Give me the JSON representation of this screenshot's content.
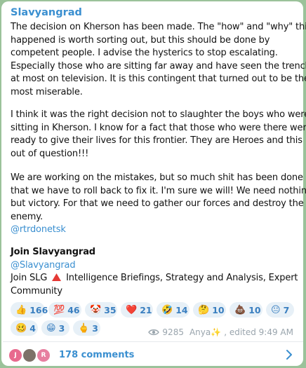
{
  "channel": {
    "name": "Slavyangrad"
  },
  "post": {
    "para1": [
      "The decision on Kherson has been made. The \"how\" and \"why\" this",
      "happened is worth sorting out, but this should be done by",
      "competent people. I advise the hysterics to stop escalating.",
      "Especially those who are sitting far away and have seen the trench",
      "at most on television. It is this contingent that turned out to be the",
      "most miserable."
    ],
    "para2": [
      "I think it was the right decision not to slaughter the boys who were",
      "sitting in Kherson. I know for a fact that those who were there were",
      "ready to give their lives for this frontier. They are Heroes and this is",
      "out of question!!!"
    ],
    "para3": [
      "We are working on the mistakes, but so much shit has been done",
      "that we have to roll back to fix it. I'm sure we will! We need nothing",
      "but victory. For that we need to gather our forces and destroy the",
      "enemy."
    ],
    "source_link": "@rtrdonetsk",
    "join_title": "Join Slavyangrad",
    "join_link": "@Slavyangrad",
    "join_prefix": "Join SLG",
    "join_suffix": "Intelligence Briefings, Strategy and Analysis, Expert",
    "join_suffix2": "Community"
  },
  "reactions": [
    {
      "emoji": "👍",
      "count": "166"
    },
    {
      "emoji": "💯",
      "count": "46"
    },
    {
      "emoji": "🤡",
      "count": "35"
    },
    {
      "emoji": "❤️",
      "count": "21"
    },
    {
      "emoji": "🤣",
      "count": "14"
    },
    {
      "emoji": "🤔",
      "count": "10"
    },
    {
      "emoji": "💩",
      "count": "10"
    },
    {
      "emoji": "😐",
      "count": "7"
    },
    {
      "emoji": "🥴",
      "count": "4"
    },
    {
      "emoji": "😁",
      "count": "3"
    },
    {
      "emoji": "🖕",
      "count": "3"
    }
  ],
  "meta": {
    "views": "9285",
    "author": "Anya✨",
    "edited": ", edited 9:49 AM"
  },
  "comments": {
    "avatars": [
      {
        "letter": "J",
        "color": "#e86a8e"
      },
      {
        "letter": "",
        "color": "#7d7168"
      },
      {
        "letter": "R",
        "color": "#e77fa0"
      }
    ],
    "label": "178 comments"
  },
  "colors": {
    "accent": "#3a8fd0",
    "chip_bg": "#e7f0f7",
    "background": "#9bc29a",
    "triangle": "#e53935"
  },
  "icons": [
    "eye-icon",
    "chevron-right-icon",
    "triangle-icon"
  ]
}
